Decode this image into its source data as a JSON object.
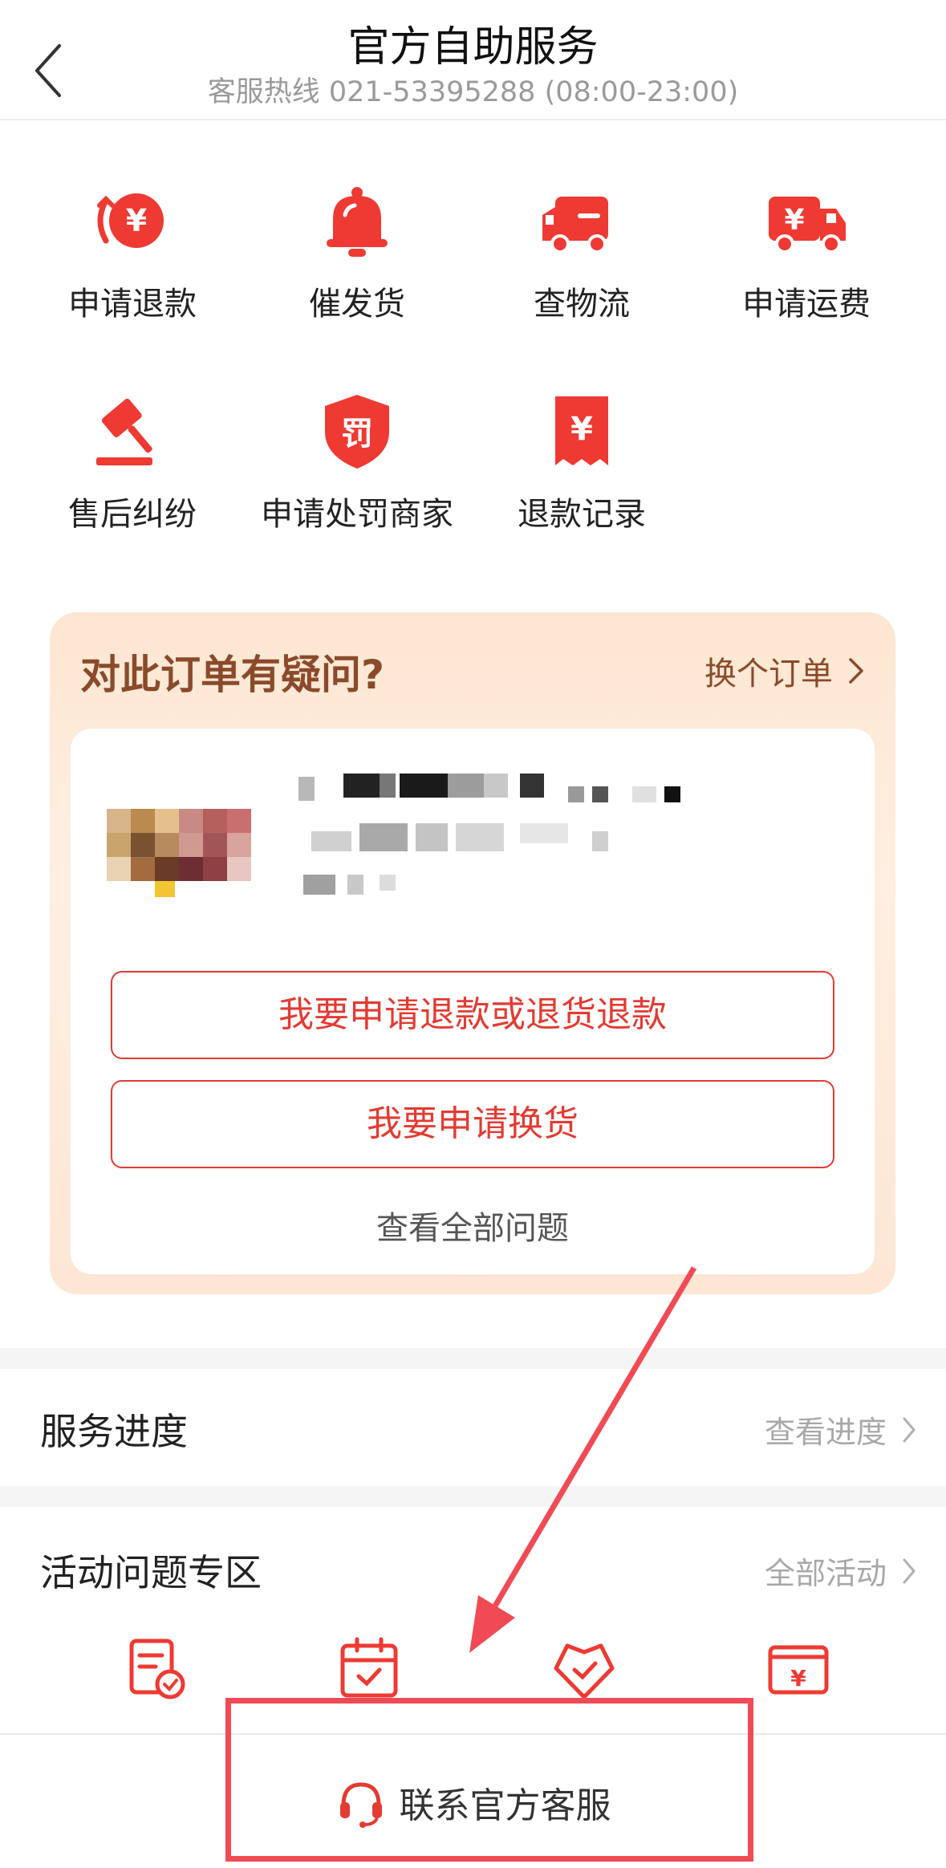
{
  "header": {
    "title": "官方自助服务",
    "hotline": "客服热线 021-53395288 (08:00-23:00)"
  },
  "services": [
    {
      "label": "申请退款",
      "icon": "refund-yuan-icon"
    },
    {
      "label": "催发货",
      "icon": "bell-icon"
    },
    {
      "label": "查物流",
      "icon": "truck-icon"
    },
    {
      "label": "申请运费",
      "icon": "shipping-fee-truck-icon"
    },
    {
      "label": "售后纠纷",
      "icon": "gavel-icon"
    },
    {
      "label": "申请处罚商家",
      "icon": "penalty-shield-icon"
    },
    {
      "label": "退款记录",
      "icon": "refund-record-icon"
    }
  ],
  "order": {
    "question": "对此订单有疑问?",
    "switch_label": "换个订单",
    "refund_button": "我要申请退款或退货退款",
    "exchange_button": "我要申请换货",
    "view_all": "查看全部问题"
  },
  "progress": {
    "title": "服务进度",
    "link": "查看进度"
  },
  "activity": {
    "title": "活动问题专区",
    "link": "全部活动",
    "items": [
      {
        "icon": "document-check-icon"
      },
      {
        "icon": "calendar-check-icon"
      },
      {
        "icon": "heart-check-icon"
      },
      {
        "icon": "yuan-card-icon"
      }
    ]
  },
  "bottom": {
    "contact_label": "联系官方客服",
    "icon": "headset-icon"
  },
  "colors": {
    "accent": "#e33b32",
    "annotation": "#f04b55",
    "card_title": "#8a4a2b"
  }
}
